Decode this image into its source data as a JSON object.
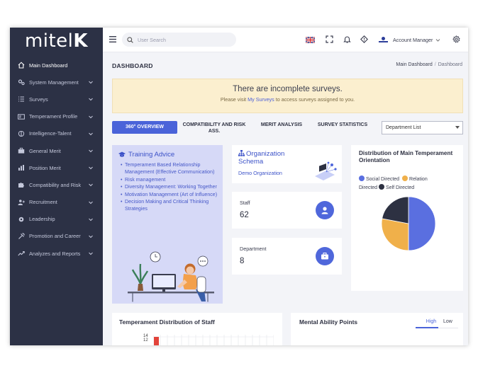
{
  "app": {
    "logo": "mitel",
    "logo_k": "K"
  },
  "sidebar": {
    "items": [
      {
        "label": "Main Dashboard",
        "icon": "home-icon",
        "active": true,
        "has_children": false
      },
      {
        "label": "System Management",
        "icon": "gears-icon",
        "has_children": true
      },
      {
        "label": "Surveys",
        "icon": "list-icon",
        "has_children": true
      },
      {
        "label": "Temperament Profile",
        "icon": "id-card-icon",
        "has_children": true
      },
      {
        "label": "Intelligence-Talent",
        "icon": "brain-icon",
        "has_children": true
      },
      {
        "label": "General Merit",
        "icon": "briefcase-icon",
        "has_children": true
      },
      {
        "label": "Position Merit",
        "icon": "chart-bars-icon",
        "has_children": true
      },
      {
        "label": "Compatibility and Risk",
        "icon": "puzzle-icon",
        "has_children": true
      },
      {
        "label": "Recruitment",
        "icon": "user-plus-icon",
        "has_children": true
      },
      {
        "label": "Leadership",
        "icon": "cog-icon",
        "has_children": true
      },
      {
        "label": "Promotion and Career",
        "icon": "tools-icon",
        "has_children": true
      },
      {
        "label": "Analyzes and Reports",
        "icon": "trend-icon",
        "has_children": true
      }
    ]
  },
  "topbar": {
    "search_placeholder": "User Search",
    "account_label": "Account Manager"
  },
  "page": {
    "title": "DASHBOARD",
    "breadcrumb": [
      "Main Dashboard",
      "Dashboard"
    ]
  },
  "alert": {
    "heading": "There are incomplete surveys.",
    "text_before": "Please visit ",
    "link": "My Surveys",
    "text_after": " to access surveys assigned to you."
  },
  "tabs": [
    {
      "label": "360° OVERVIEW",
      "active": true
    },
    {
      "label": "COMPATIBILITY AND RISK ASS.",
      "active": false
    },
    {
      "label": "MERIT ANALYSIS",
      "active": false
    },
    {
      "label": "SURVEY STATISTICS",
      "active": false
    }
  ],
  "department_select": {
    "value": "Department List"
  },
  "training": {
    "title": "Training Advice",
    "items": [
      "Temperament Based Relationship Management (Effective Communication)",
      "Risk management",
      "Diversity Management: Working Together",
      "Motivation Management (Art of Influence)",
      "Decision Making and Critical Thinking Strategies"
    ]
  },
  "org": {
    "title": "Organization Schema",
    "subtitle": "Demo Organization"
  },
  "stats": [
    {
      "label": "Staff",
      "value": "62",
      "icon": "user-icon"
    },
    {
      "label": "Department",
      "value": "8",
      "icon": "briefcase-icon"
    }
  ],
  "temperament_pie": {
    "title": "Distribution of Main Temperament Orientation",
    "legend_social": "Social Directed",
    "legend_relation": "Relation",
    "legend_directed": "Directed",
    "legend_self": "Self Directed"
  },
  "chart_data": {
    "type": "pie",
    "title": "Distribution of Main Temperament Orientation",
    "labels": [
      "Social Directed",
      "Relation Directed",
      "Self Directed"
    ],
    "values": [
      50,
      28,
      22
    ],
    "colors": [
      "#5a6fe0",
      "#f0b04a",
      "#2d3142"
    ]
  },
  "staff_chart": {
    "title": "Temperament Distribution of Staff",
    "y_ticks": [
      "14",
      "12"
    ]
  },
  "mental": {
    "title": "Mental Ability Points",
    "tab_high": "High",
    "tab_low": "Low"
  },
  "colors": {
    "primary": "#4a63d9",
    "sidebar": "#2c3145",
    "alert_bg": "#fbefcf",
    "training_bg": "#d6d9f7"
  }
}
